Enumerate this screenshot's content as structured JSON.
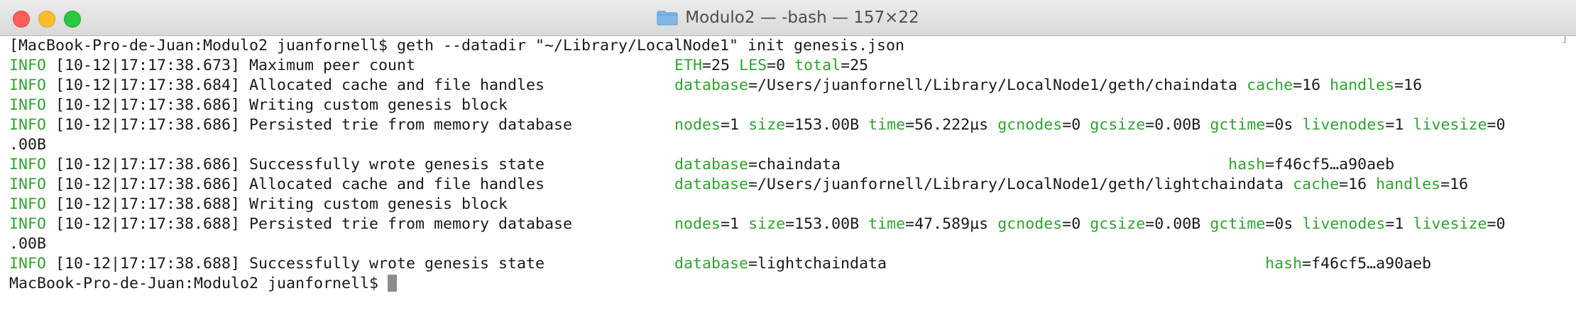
{
  "window": {
    "title": "Modulo2 — -bash — 157×22",
    "controls": {
      "close": "#fe5f57",
      "minimize": "#febc2e",
      "maximize": "#28c840"
    },
    "title_icon": "folder-icon"
  },
  "colors": {
    "info_green": "#2fa32f",
    "text": "#1a1a1a",
    "background": "#ffffff"
  },
  "terminal": {
    "command_line": "[MacBook-Pro-de-Juan:Modulo2 juanfornell$ geth --datadir \"~/Library/LocalNode1\" init genesis.json",
    "lines": [
      {
        "level": "INFO",
        "ts": " [10-12|17:17:38.673]",
        "msg": " Maximum peer count",
        "kvs": [
          {
            "k": "ETH",
            "v": "25"
          },
          {
            "sep": " "
          },
          {
            "k": "LES",
            "v": "0"
          },
          {
            "sep": " "
          },
          {
            "k": "total",
            "v": "25"
          }
        ]
      },
      {
        "level": "INFO",
        "ts": " [10-12|17:17:38.684]",
        "msg": " Allocated cache and file handles",
        "kvs": [
          {
            "k": "database",
            "v": "/Users/juanfornell/Library/LocalNode1/geth/chaindata"
          },
          {
            "sep": " "
          },
          {
            "k": "cache",
            "v": "16"
          },
          {
            "sep": " "
          },
          {
            "k": "handles",
            "v": "16"
          }
        ]
      },
      {
        "level": "INFO",
        "ts": " [10-12|17:17:38.686]",
        "msg": " Writing custom genesis block",
        "kvs": []
      },
      {
        "level": "INFO",
        "ts": " [10-12|17:17:38.686]",
        "msg": " Persisted trie from memory database",
        "kvs": [
          {
            "k": "nodes",
            "v": "1"
          },
          {
            "sep": " "
          },
          {
            "k": "size",
            "v": "153.00B"
          },
          {
            "sep": " "
          },
          {
            "k": "time",
            "v": "56.222µs"
          },
          {
            "sep": " "
          },
          {
            "k": "gcnodes",
            "v": "0"
          },
          {
            "sep": " "
          },
          {
            "k": "gcsize",
            "v": "0.00B"
          },
          {
            "sep": " "
          },
          {
            "k": "gctime",
            "v": "0s"
          },
          {
            "sep": " "
          },
          {
            "k": "livenodes",
            "v": "1"
          },
          {
            "sep": " "
          },
          {
            "k": "livesize",
            "v": "0"
          }
        ]
      },
      {
        "plain": ".00B"
      },
      {
        "level": "INFO",
        "ts": " [10-12|17:17:38.686]",
        "msg": " Successfully wrote genesis state",
        "kvs": [
          {
            "k": "database",
            "v": "chaindata"
          },
          {
            "sep": "                                          "
          },
          {
            "k": "hash",
            "v": "f46cf5…a90aeb"
          }
        ]
      },
      {
        "level": "INFO",
        "ts": " [10-12|17:17:38.686]",
        "msg": " Allocated cache and file handles",
        "kvs": [
          {
            "k": "database",
            "v": "/Users/juanfornell/Library/LocalNode1/geth/lightchaindata"
          },
          {
            "sep": " "
          },
          {
            "k": "cache",
            "v": "16"
          },
          {
            "sep": " "
          },
          {
            "k": "handles",
            "v": "16"
          }
        ]
      },
      {
        "level": "INFO",
        "ts": " [10-12|17:17:38.688]",
        "msg": " Writing custom genesis block",
        "kvs": []
      },
      {
        "level": "INFO",
        "ts": " [10-12|17:17:38.688]",
        "msg": " Persisted trie from memory database",
        "kvs": [
          {
            "k": "nodes",
            "v": "1"
          },
          {
            "sep": " "
          },
          {
            "k": "size",
            "v": "153.00B"
          },
          {
            "sep": " "
          },
          {
            "k": "time",
            "v": "47.589µs"
          },
          {
            "sep": " "
          },
          {
            "k": "gcnodes",
            "v": "0"
          },
          {
            "sep": " "
          },
          {
            "k": "gcsize",
            "v": "0.00B"
          },
          {
            "sep": " "
          },
          {
            "k": "gctime",
            "v": "0s"
          },
          {
            "sep": " "
          },
          {
            "k": "livenodes",
            "v": "1"
          },
          {
            "sep": " "
          },
          {
            "k": "livesize",
            "v": "0"
          }
        ]
      },
      {
        "plain": ".00B"
      },
      {
        "level": "INFO",
        "ts": " [10-12|17:17:38.688]",
        "msg": " Successfully wrote genesis state",
        "kvs": [
          {
            "k": "database",
            "v": "lightchaindata"
          },
          {
            "sep": "                                         "
          },
          {
            "k": "hash",
            "v": "f46cf5…a90aeb"
          }
        ]
      }
    ],
    "prompt": "MacBook-Pro-de-Juan:Modulo2 juanfornell$ ",
    "right_bracket": "]"
  }
}
